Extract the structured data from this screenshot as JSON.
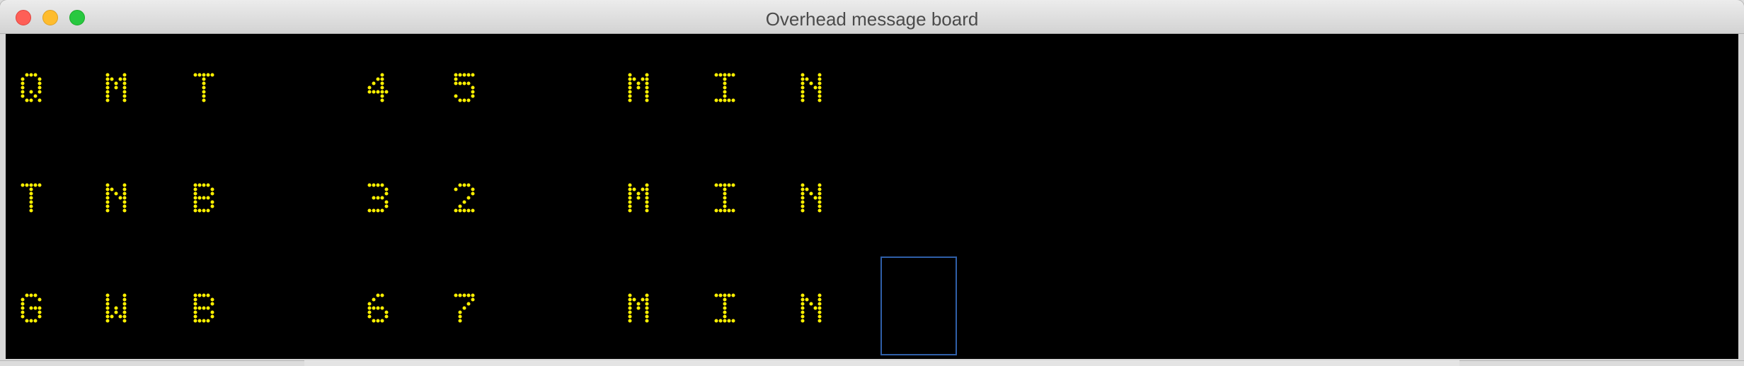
{
  "window": {
    "title": "Overhead message board"
  },
  "board": {
    "led_color": "#fff000",
    "background_color": "#000000",
    "rows": [
      {
        "cells": [
          "Q",
          "M",
          "T",
          "",
          "4",
          "5",
          "",
          "M",
          "I",
          "N"
        ]
      },
      {
        "cells": [
          "T",
          "N",
          "B",
          "",
          "3",
          "2",
          "",
          "M",
          "I",
          "N"
        ]
      },
      {
        "cells": [
          "G",
          "W",
          "B",
          "",
          "6",
          "7",
          "",
          "M",
          "I",
          "N"
        ]
      }
    ],
    "cursor": {
      "row": 3,
      "column": 11
    }
  }
}
